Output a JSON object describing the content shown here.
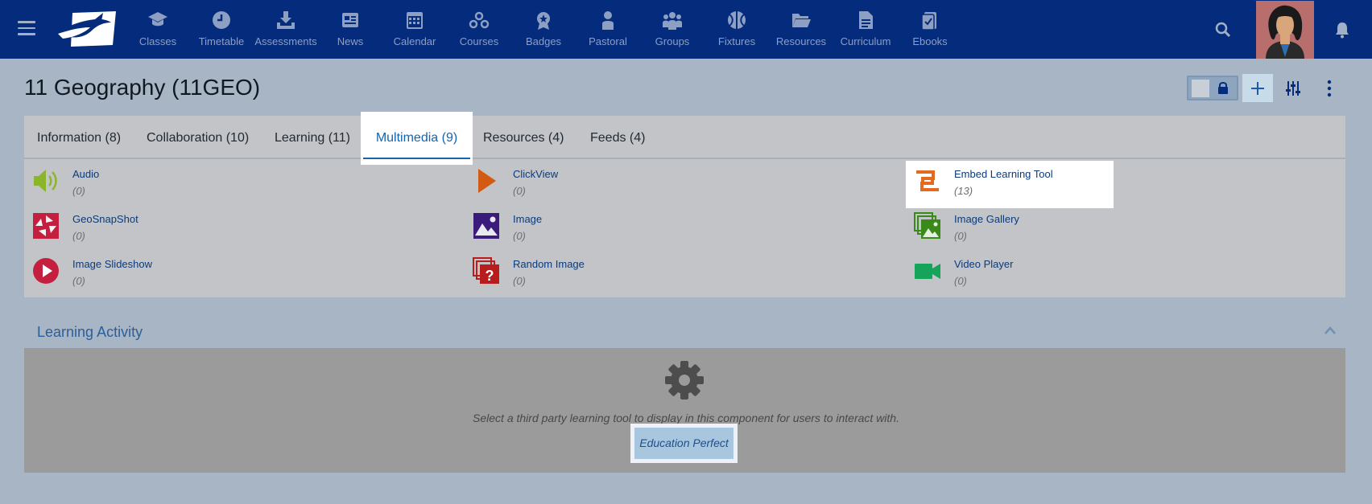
{
  "nav": {
    "items": [
      {
        "label": "Classes",
        "icon": "graduation-cap-icon"
      },
      {
        "label": "Timetable",
        "icon": "clock-icon"
      },
      {
        "label": "Assessments",
        "icon": "download-tray-icon"
      },
      {
        "label": "News",
        "icon": "newspaper-icon"
      },
      {
        "label": "Calendar",
        "icon": "calendar-icon"
      },
      {
        "label": "Courses",
        "icon": "nodes-icon"
      },
      {
        "label": "Badges",
        "icon": "badge-icon"
      },
      {
        "label": "Pastoral",
        "icon": "person-icon"
      },
      {
        "label": "Groups",
        "icon": "group-icon"
      },
      {
        "label": "Fixtures",
        "icon": "ball-icon"
      },
      {
        "label": "Resources",
        "icon": "folder-icon"
      },
      {
        "label": "Curriculum",
        "icon": "document-icon"
      },
      {
        "label": "Ebooks",
        "icon": "ebook-icon"
      }
    ]
  },
  "page": {
    "title": "11 Geography (11GEO)"
  },
  "tabs": [
    {
      "label": "Information (8)"
    },
    {
      "label": "Collaboration (10)"
    },
    {
      "label": "Learning (11)"
    },
    {
      "label": "Multimedia (9)"
    },
    {
      "label": "Resources (4)"
    },
    {
      "label": "Feeds (4)"
    }
  ],
  "tools": [
    {
      "name": "Audio",
      "count": "(0)",
      "icon": "speaker-icon"
    },
    {
      "name": "ClickView",
      "count": "(0)",
      "icon": "play-triangle-icon"
    },
    {
      "name": "Embed Learning Tool",
      "count": "(13)",
      "icon": "embed-icon"
    },
    {
      "name": "GeoSnapShot",
      "count": "(0)",
      "icon": "camera-shutter-icon"
    },
    {
      "name": "Image",
      "count": "(0)",
      "icon": "image-icon"
    },
    {
      "name": "Image Gallery",
      "count": "(0)",
      "icon": "image-gallery-icon"
    },
    {
      "name": "Image Slideshow",
      "count": "(0)",
      "icon": "play-circle-icon"
    },
    {
      "name": "Random Image",
      "count": "(0)",
      "icon": "question-stack-icon"
    },
    {
      "name": "Video Player",
      "count": "(0)",
      "icon": "video-camera-icon"
    }
  ],
  "learning_activity": {
    "title": "Learning Activity",
    "description": "Select a third party learning tool to display in this component for users to interact with.",
    "button": "Education Perfect"
  },
  "colors": {
    "nav_bg": "#052b7d",
    "accent": "#1464b0",
    "page_bg": "#a7b5c4"
  }
}
